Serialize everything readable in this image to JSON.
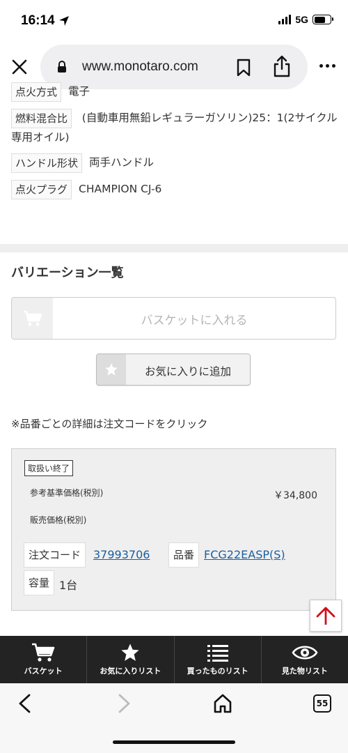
{
  "status_bar": {
    "time": "16:14",
    "network": "5G"
  },
  "browser": {
    "url": "www.monotaro.com",
    "tab_count": "55"
  },
  "specs": [
    {
      "label": "点火方式",
      "value": "電子"
    },
    {
      "label": "燃料混合比",
      "value": "(自動車用無鉛レギュラーガソリン)25：1(2サイクル専用オイル)"
    },
    {
      "label": "ハンドル形状",
      "value": "両手ハンドル"
    },
    {
      "label": "点火プラグ",
      "value": "CHAMPION CJ-6"
    }
  ],
  "variation": {
    "title": "バリエーション一覧",
    "basket_label": "バスケットに入れる",
    "favorite_label": "お気に入りに追加",
    "note": "※品番ごとの詳細は注文コードをクリック"
  },
  "item": {
    "status": "取扱い終了",
    "reference_price_label": "参考基準価格(税別)",
    "reference_price_value": "￥34,800",
    "sale_price_label": "販売価格(税別)",
    "order_code_label": "注文コード",
    "order_code": "37993706",
    "part_number_label": "品番",
    "part_number": "FCG22EASP(S)",
    "capacity_label": "容量",
    "capacity": "1台"
  },
  "tabbar": [
    {
      "label": "バスケット",
      "icon": "cart-icon"
    },
    {
      "label": "お気に入りリスト",
      "icon": "star-icon"
    },
    {
      "label": "買ったものリスト",
      "icon": "list-icon"
    },
    {
      "label": "見た物リスト",
      "icon": "eye-icon"
    }
  ],
  "colors": {
    "link": "#1a5fa0",
    "tabbar_bg": "#232323",
    "scroll_arrow": "#d0101b"
  }
}
